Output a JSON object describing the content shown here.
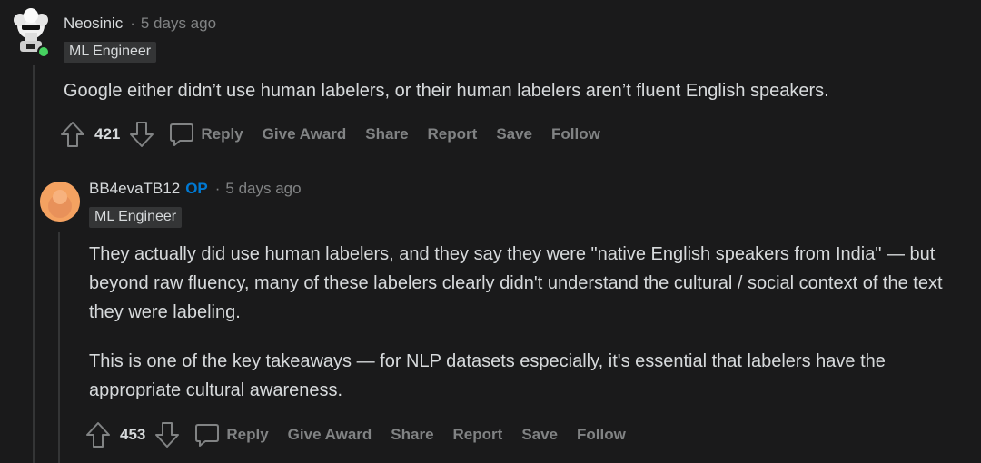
{
  "comments": [
    {
      "author": "Neosinic",
      "separator": "·",
      "time": "5 days ago",
      "flair": "ML Engineer",
      "body": [
        "Google either didn’t use human labelers, or their human labelers aren’t fluent English speakers."
      ],
      "score": "421",
      "actions": {
        "reply": "Reply",
        "award": "Give Award",
        "share": "Share",
        "report": "Report",
        "save": "Save",
        "follow": "Follow"
      },
      "avatar_icon": "robot-avatar-icon",
      "online": true
    },
    {
      "author": "BB4evaTB12",
      "op_badge": "OP",
      "separator": "·",
      "time": "5 days ago",
      "flair": "ML Engineer",
      "body": [
        "They actually did use human labelers, and they say they were \"native English speakers from India\" — but beyond raw fluency, many of these labelers clearly didn't understand the cultural / social context of the text they were labeling.",
        "This is one of the key takeaways — for NLP datasets especially, it's essential that labelers have the appropriate cultural awareness."
      ],
      "score": "453",
      "actions": {
        "reply": "Reply",
        "award": "Give Award",
        "share": "Share",
        "report": "Report",
        "save": "Save",
        "follow": "Follow"
      },
      "avatar_icon": "default-orange-avatar-icon"
    }
  ],
  "colors": {
    "background": "#1a1a1b",
    "text": "#d7dadc",
    "muted": "#818384",
    "op_blue": "#0079d3",
    "flair_bg": "#343536",
    "online_green": "#46d160",
    "avatar_orange": "#f4a261"
  }
}
